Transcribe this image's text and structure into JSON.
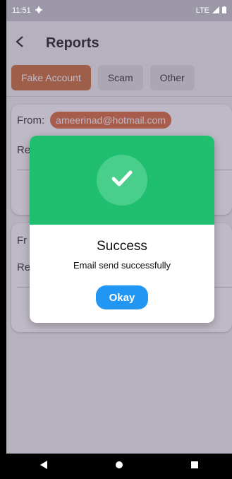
{
  "status_bar": {
    "time": "11:51",
    "network": "LTE"
  },
  "app_bar": {
    "title": "Reports"
  },
  "tabs": [
    {
      "label": "Fake Account",
      "active": true
    },
    {
      "label": "Scam",
      "active": false
    },
    {
      "label": "Other",
      "active": false
    }
  ],
  "cards": [
    {
      "from_label": "From:",
      "email": "ameerinad@hotmail.com",
      "reason_prefix": "Re"
    },
    {
      "from_label": "Fr",
      "reason_prefix": "Re"
    }
  ],
  "dialog": {
    "title": "Success",
    "message": "Email send successfully",
    "button": "Okay"
  },
  "colors": {
    "accent": "#c8652a",
    "success": "#1fbf6f",
    "button": "#2196f3"
  }
}
